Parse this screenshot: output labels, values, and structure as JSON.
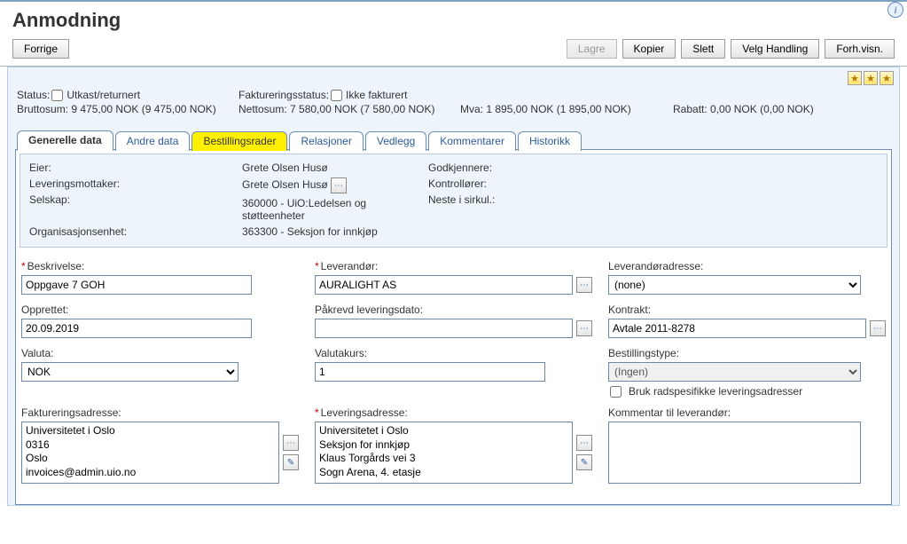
{
  "page": {
    "title": "Anmodning"
  },
  "toolbar": {
    "prev": "Forrige",
    "save": "Lagre",
    "copy": "Kopier",
    "delete": "Slett",
    "choose_action": "Velg Handling",
    "preview": "Forh.visn."
  },
  "summary": {
    "status_label": "Status:",
    "status_value": "Utkast/returnert",
    "invoice_status_label": "Faktureringsstatus:",
    "invoice_status_value": "Ikke fakturert",
    "gross_label": "Bruttosum:",
    "gross_value": "9 475,00 NOK (9 475,00 NOK)",
    "net_label": "Nettosum:",
    "net_value": "7 580,00 NOK (7 580,00 NOK)",
    "vat_label": "Mva:",
    "vat_value": "1 895,00 NOK (1 895,00 NOK)",
    "discount_label": "Rabatt:",
    "discount_value": "0,00 NOK (0,00 NOK)"
  },
  "tabs": {
    "general": "Generelle data",
    "other": "Andre data",
    "order_lines": "Bestillingsrader",
    "relations": "Relasjoner",
    "attachments": "Vedlegg",
    "comments": "Kommentarer",
    "history": "Historikk"
  },
  "owners": {
    "owner_label": "Eier:",
    "owner_value": "Grete Olsen Husø",
    "recipient_label": "Leveringsmottaker:",
    "recipient_value": "Grete Olsen Husø",
    "company_label": "Selskap:",
    "company_value": "360000 - UiO:Ledelsen og støtteenheter",
    "orgunit_label": "Organisasjonsenhet:",
    "orgunit_value": "363300 - Seksjon for innkjøp",
    "approvers_label": "Godkjennere:",
    "controllers_label": "Kontrollører:",
    "next_label": "Neste i sirkul.:"
  },
  "form": {
    "desc_label": "Beskrivelse:",
    "desc_value": "Oppgave 7 GOH",
    "created_label": "Opprettet:",
    "created_value": "20.09.2019",
    "currency_label": "Valuta:",
    "currency_value": "NOK",
    "invoice_addr_label": "Faktureringsadresse:",
    "invoice_addr_value": "Universitetet i Oslo\n0316\nOslo\ninvoices@admin.uio.no",
    "supplier_label": "Leverandør:",
    "supplier_value": "AURALIGHT AS",
    "req_delivery_label": "Påkrevd leveringsdato:",
    "req_delivery_value": "",
    "exchange_label": "Valutakurs:",
    "exchange_value": "1",
    "delivery_addr_label": "Leveringsadresse:",
    "delivery_addr_value": "Universitetet i Oslo\nSeksjon for innkjøp\nKlaus Torgårds vei 3\nSogn Arena, 4. etasje",
    "supplier_addr_label": "Leverandøradresse:",
    "supplier_addr_value": "(none)",
    "contract_label": "Kontrakt:",
    "contract_value": "Avtale 2011-8278",
    "order_type_label": "Bestillingstype:",
    "order_type_value": "(Ingen)",
    "row_specific_label": "Bruk radspesifikke leveringsadresser",
    "supplier_comment_label": "Kommentar til leverandør:",
    "supplier_comment_value": ""
  }
}
